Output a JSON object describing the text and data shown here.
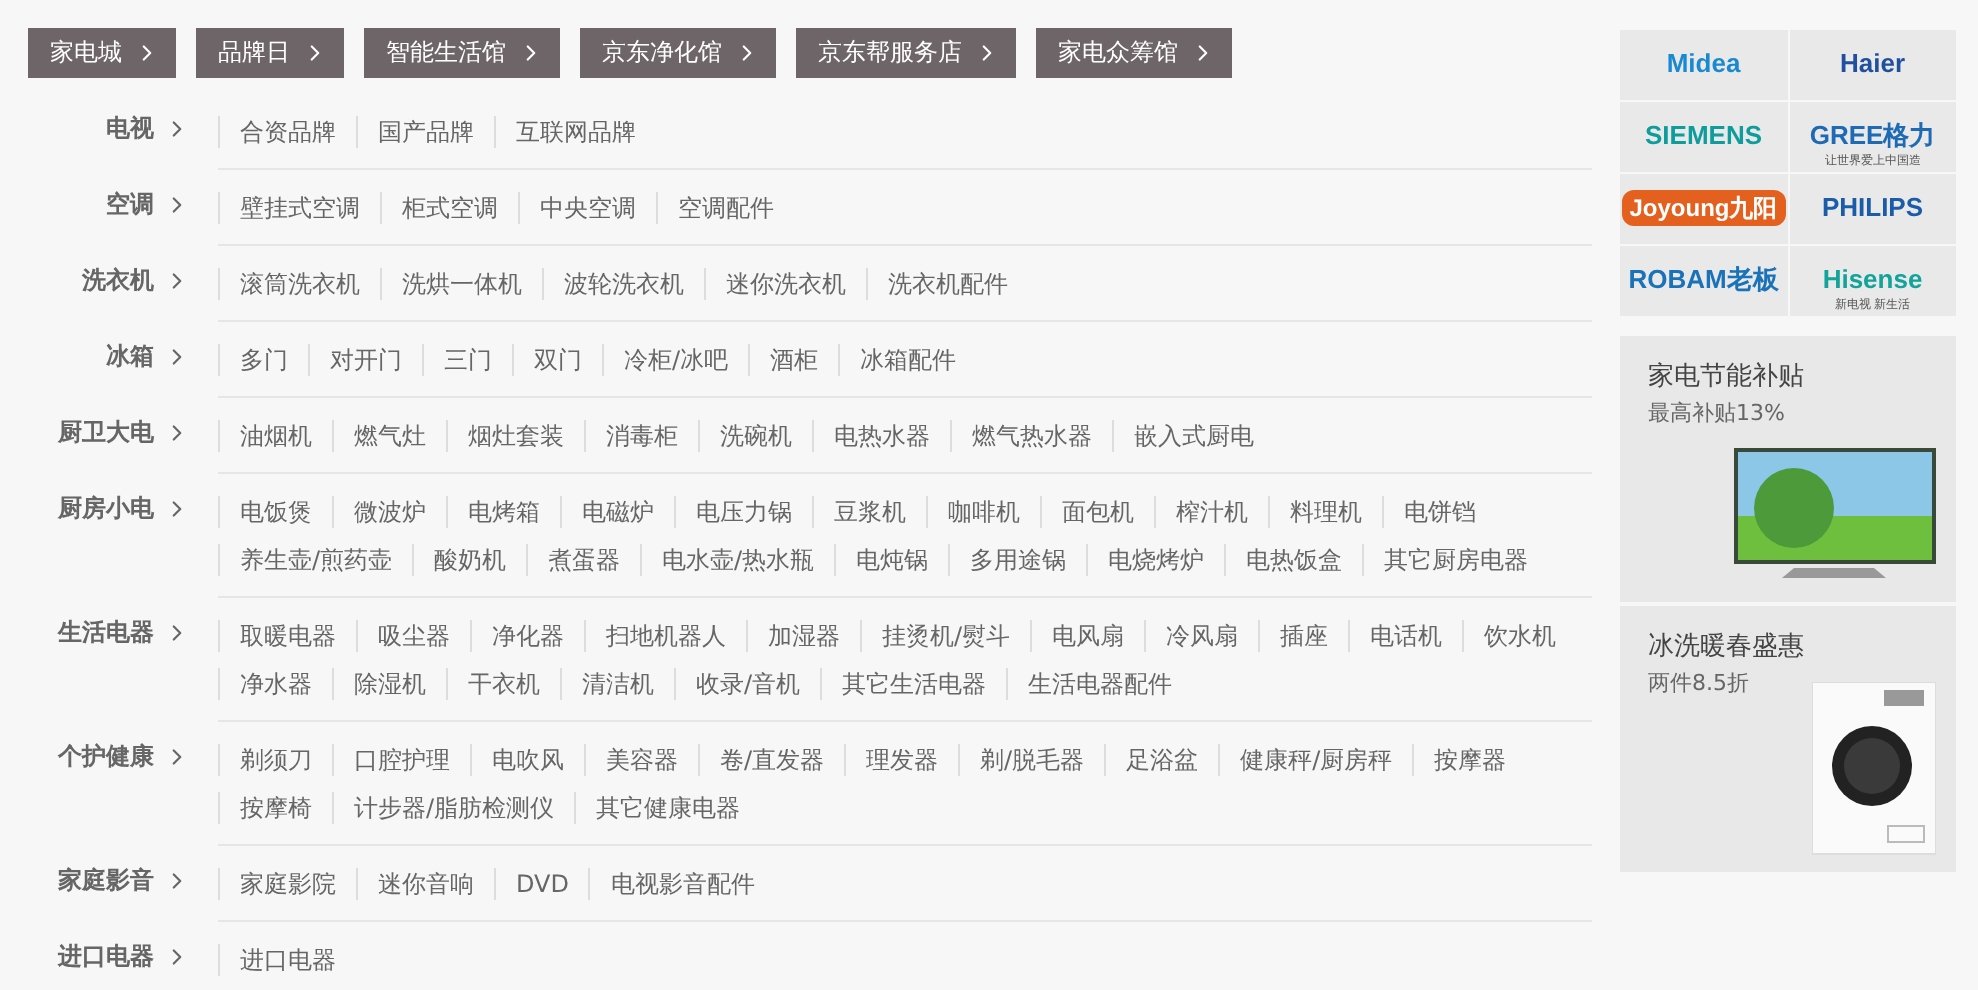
{
  "top_links": [
    "家电城",
    "品牌日",
    "智能生活馆",
    "京东净化馆",
    "京东帮服务店",
    "家电众筹馆"
  ],
  "categories": [
    {
      "label": "电视",
      "items": [
        "合资品牌",
        "国产品牌",
        "互联网品牌"
      ]
    },
    {
      "label": "空调",
      "items": [
        "壁挂式空调",
        "柜式空调",
        "中央空调",
        "空调配件"
      ]
    },
    {
      "label": "洗衣机",
      "items": [
        "滚筒洗衣机",
        "洗烘一体机",
        "波轮洗衣机",
        "迷你洗衣机",
        "洗衣机配件"
      ]
    },
    {
      "label": "冰箱",
      "items": [
        "多门",
        "对开门",
        "三门",
        "双门",
        "冷柜/冰吧",
        "酒柜",
        "冰箱配件"
      ]
    },
    {
      "label": "厨卫大电",
      "items": [
        "油烟机",
        "燃气灶",
        "烟灶套装",
        "消毒柜",
        "洗碗机",
        "电热水器",
        "燃气热水器",
        "嵌入式厨电"
      ]
    },
    {
      "label": "厨房小电",
      "items": [
        "电饭煲",
        "微波炉",
        "电烤箱",
        "电磁炉",
        "电压力锅",
        "豆浆机",
        "咖啡机",
        "面包机",
        "榨汁机",
        "料理机",
        "电饼铛",
        "养生壶/煎药壶",
        "酸奶机",
        "煮蛋器",
        "电水壶/热水瓶",
        "电炖锅",
        "多用途锅",
        "电烧烤炉",
        "电热饭盒",
        "其它厨房电器"
      ]
    },
    {
      "label": "生活电器",
      "items": [
        "取暖电器",
        "吸尘器",
        "净化器",
        "扫地机器人",
        "加湿器",
        "挂烫机/熨斗",
        "电风扇",
        "冷风扇",
        "插座",
        "电话机",
        "饮水机",
        "净水器",
        "除湿机",
        "干衣机",
        "清洁机",
        "收录/音机",
        "其它生活电器",
        "生活电器配件"
      ]
    },
    {
      "label": "个护健康",
      "items": [
        "剃须刀",
        "口腔护理",
        "电吹风",
        "美容器",
        "卷/直发器",
        "理发器",
        "剃/脱毛器",
        "足浴盆",
        "健康秤/厨房秤",
        "按摩器",
        "按摩椅",
        "计步器/脂肪检测仪",
        "其它健康电器"
      ]
    },
    {
      "label": "家庭影音",
      "items": [
        "家庭影院",
        "迷你音响",
        "DVD",
        "电视影音配件"
      ]
    },
    {
      "label": "进口电器",
      "items": [
        "进口电器"
      ]
    }
  ],
  "brands": [
    {
      "name": "Midea",
      "kind": "plain",
      "color": "#1a8ad0"
    },
    {
      "name": "Haier",
      "kind": "plain",
      "color": "#1f4f9e"
    },
    {
      "name": "SIEMENS",
      "kind": "plain",
      "color": "#0f9c9c"
    },
    {
      "name": "GREE格力",
      "tagline": "让世界爱上中国造",
      "kind": "plain",
      "color": "#1e6ab4"
    },
    {
      "name": "Joyoung九阳",
      "kind": "filled",
      "color": "#e4601e"
    },
    {
      "name": "PHILIPS",
      "kind": "plain",
      "color": "#1b5ca8"
    },
    {
      "name": "ROBAM老板",
      "kind": "plain",
      "color": "#1a72b8"
    },
    {
      "name": "Hisense",
      "tagline": "新电视  新生活",
      "kind": "plain",
      "color": "#12a39a"
    }
  ],
  "promos": [
    {
      "title": "家电节能补贴",
      "subtitle": "最高补贴13%",
      "kind": "tv"
    },
    {
      "title": "冰洗暖春盛惠",
      "subtitle": "两件8.5折",
      "kind": "washer"
    }
  ]
}
